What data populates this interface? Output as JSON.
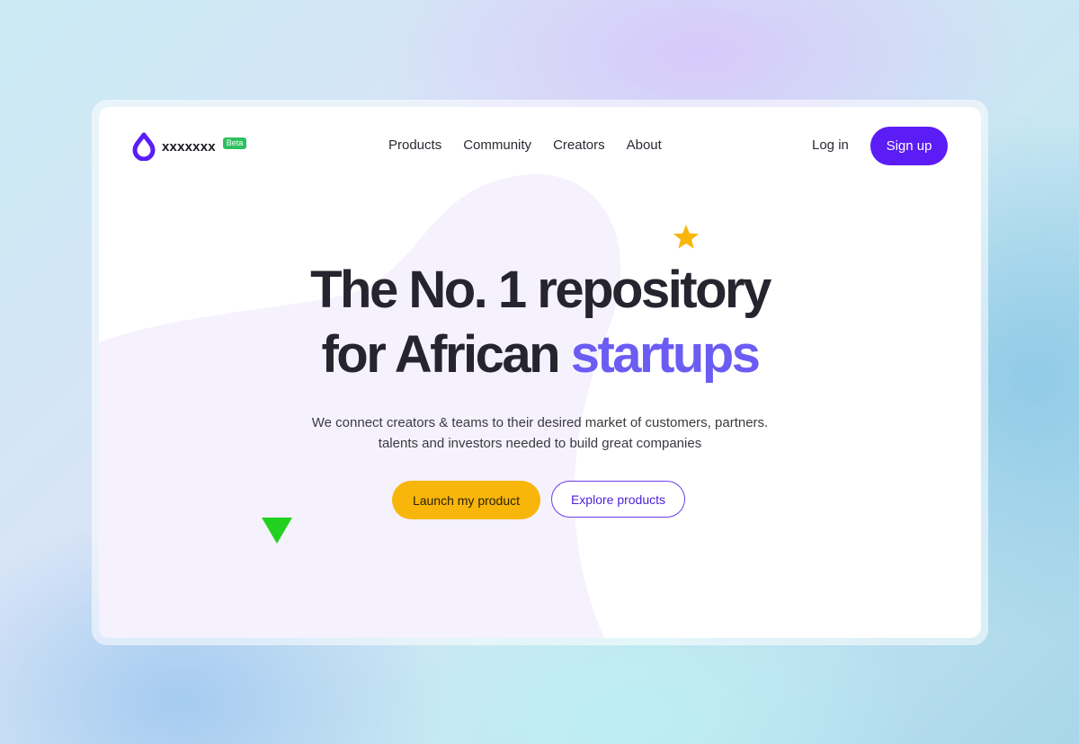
{
  "header": {
    "brand_name": "xxxxxxx",
    "beta_label": "Beta",
    "nav": [
      {
        "label": "Products"
      },
      {
        "label": "Community"
      },
      {
        "label": "Creators"
      },
      {
        "label": "About"
      }
    ],
    "login_label": "Log in",
    "signup_label": "Sign up"
  },
  "hero": {
    "title_line1": "The No. 1 repository",
    "title_line2_prefix": "for African ",
    "title_line2_accent": "startups",
    "subtitle_line1": "We connect creators & teams to their desired market of customers, partners.",
    "subtitle_line2": "talents and investors needed to build great companies",
    "primary_cta": "Launch my product",
    "secondary_cta": "Explore products"
  },
  "icons": [
    "drop-logo-icon",
    "star-icon",
    "triangle-icon"
  ],
  "colors": {
    "brand": "#5b1cf5",
    "accent_text": "#6b5cf3",
    "primary_cta": "#f8b50a",
    "beta_badge": "#2fbf5f",
    "star": "#f8b50a",
    "triangle": "#22d11f"
  }
}
